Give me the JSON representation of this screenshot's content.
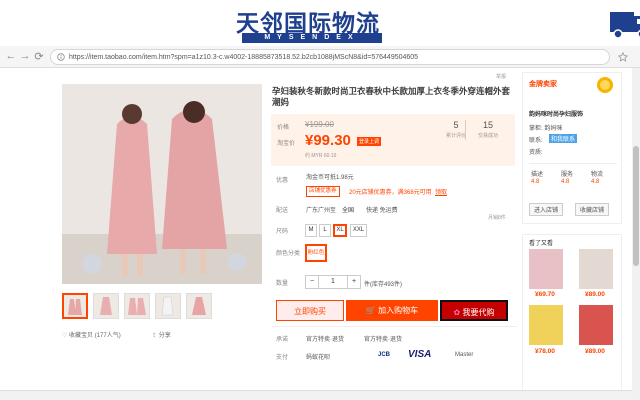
{
  "banner": {
    "logo_cn": "天邻国际物流",
    "logo_en": "MYSENDEX"
  },
  "browser": {
    "url": "https://item.taobao.com/item.htm?spm=a1z10.3-c.w4002-18885873518.52.b2cb1088jMScN8&id=576449504605",
    "back": "←",
    "forward": "→",
    "reload": "⟳"
  },
  "product": {
    "title": "孕妇装秋冬新款时尚卫衣春秋中长款加厚上衣冬季外穿连帽外套潮妈",
    "report": "举报",
    "price": {
      "label_price": "价格",
      "original": "¥199.00",
      "label_sale": "淘宝价",
      "current": "¥99.30",
      "tag": "登录上调",
      "sub": "约 MYR 60.19",
      "sold_count": "5",
      "sold_label": "累计评价",
      "deals_count": "15",
      "deals_label": "交易成功"
    },
    "promo": {
      "label": "优惠",
      "text": "淘金币可抵1.98元",
      "chip": "店铺优惠券",
      "coupon": "20元店铺优惠券，满368元可用",
      "get": "领取"
    },
    "shipping": {
      "label": "配送",
      "from": "广东广州至",
      "to": "全国",
      "fee": "快递 免运费",
      "extra": "月销8件"
    },
    "size": {
      "label": "尺码",
      "options": [
        "M",
        "L",
        "XL",
        "XXL"
      ],
      "selected": "XL"
    },
    "color": {
      "label": "颜色分类",
      "selected": "粉红色"
    },
    "quantity": {
      "label": "数量",
      "minus": "−",
      "value": "1",
      "plus": "+",
      "stock": "件(库存493件)"
    },
    "buttons": {
      "buy_now": "立即购买",
      "add_cart": "加入购物车",
      "agent": "我要代购"
    },
    "guarantee": {
      "label": "承诺",
      "items": [
        "官方特卖·退货",
        "官方特卖·退货"
      ]
    },
    "payment": {
      "label": "支付",
      "methods": [
        "蚂蚁花呗",
        "JCB",
        "VISA",
        "Master"
      ]
    },
    "favorite": "收藏宝贝 (177人气)",
    "share": "分享"
  },
  "shop": {
    "badge": "金牌卖家",
    "name": "韵妈咪时尚孕妇服饰",
    "owner": "掌柜: 韵妈咪",
    "contact_label": "联系:",
    "contact": "和我联系",
    "quality_label": "资质:",
    "scores": [
      {
        "label": "描述",
        "value": "4.8"
      },
      {
        "label": "服务",
        "value": "4.8"
      },
      {
        "label": "物流",
        "value": "4.8"
      }
    ],
    "enter": "进入店铺",
    "collect": "收藏店铺"
  },
  "seen": {
    "title": "看了又看",
    "prices": [
      "¥69.70",
      "¥89.00",
      "¥78.00",
      "¥89.00"
    ]
  },
  "colors": {
    "accent": "#ff4400",
    "agent": "#c40000",
    "logo": "#1f3f8f"
  }
}
